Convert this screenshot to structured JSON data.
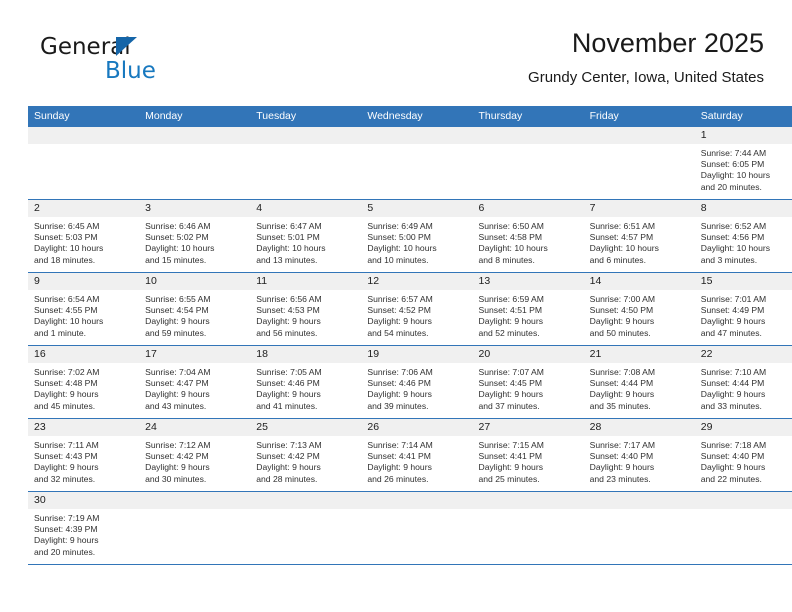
{
  "brand": {
    "name_part1": "General",
    "name_part2": "Blue",
    "triangle_color": "#1565a8",
    "blue_color": "#1778bf"
  },
  "header": {
    "title": "November 2025",
    "subtitle": "Grundy Center, Iowa, United States"
  },
  "theme": {
    "header_bg": "#3275b8",
    "header_text": "#ffffff",
    "daynum_band_bg": "#f0f0f0",
    "row_border": "#3275b8"
  },
  "weekday_headers": [
    "Sunday",
    "Monday",
    "Tuesday",
    "Wednesday",
    "Thursday",
    "Friday",
    "Saturday"
  ],
  "weeks": [
    [
      {
        "day": "",
        "empty": true
      },
      {
        "day": "",
        "empty": true
      },
      {
        "day": "",
        "empty": true
      },
      {
        "day": "",
        "empty": true
      },
      {
        "day": "",
        "empty": true
      },
      {
        "day": "",
        "empty": true
      },
      {
        "day": "1",
        "sunrise": "Sunrise: 7:44 AM",
        "sunset": "Sunset: 6:05 PM",
        "daylight1": "Daylight: 10 hours",
        "daylight2": "and 20 minutes."
      }
    ],
    [
      {
        "day": "2",
        "sunrise": "Sunrise: 6:45 AM",
        "sunset": "Sunset: 5:03 PM",
        "daylight1": "Daylight: 10 hours",
        "daylight2": "and 18 minutes."
      },
      {
        "day": "3",
        "sunrise": "Sunrise: 6:46 AM",
        "sunset": "Sunset: 5:02 PM",
        "daylight1": "Daylight: 10 hours",
        "daylight2": "and 15 minutes."
      },
      {
        "day": "4",
        "sunrise": "Sunrise: 6:47 AM",
        "sunset": "Sunset: 5:01 PM",
        "daylight1": "Daylight: 10 hours",
        "daylight2": "and 13 minutes."
      },
      {
        "day": "5",
        "sunrise": "Sunrise: 6:49 AM",
        "sunset": "Sunset: 5:00 PM",
        "daylight1": "Daylight: 10 hours",
        "daylight2": "and 10 minutes."
      },
      {
        "day": "6",
        "sunrise": "Sunrise: 6:50 AM",
        "sunset": "Sunset: 4:58 PM",
        "daylight1": "Daylight: 10 hours",
        "daylight2": "and 8 minutes."
      },
      {
        "day": "7",
        "sunrise": "Sunrise: 6:51 AM",
        "sunset": "Sunset: 4:57 PM",
        "daylight1": "Daylight: 10 hours",
        "daylight2": "and 6 minutes."
      },
      {
        "day": "8",
        "sunrise": "Sunrise: 6:52 AM",
        "sunset": "Sunset: 4:56 PM",
        "daylight1": "Daylight: 10 hours",
        "daylight2": "and 3 minutes."
      }
    ],
    [
      {
        "day": "9",
        "sunrise": "Sunrise: 6:54 AM",
        "sunset": "Sunset: 4:55 PM",
        "daylight1": "Daylight: 10 hours",
        "daylight2": "and 1 minute."
      },
      {
        "day": "10",
        "sunrise": "Sunrise: 6:55 AM",
        "sunset": "Sunset: 4:54 PM",
        "daylight1": "Daylight: 9 hours",
        "daylight2": "and 59 minutes."
      },
      {
        "day": "11",
        "sunrise": "Sunrise: 6:56 AM",
        "sunset": "Sunset: 4:53 PM",
        "daylight1": "Daylight: 9 hours",
        "daylight2": "and 56 minutes."
      },
      {
        "day": "12",
        "sunrise": "Sunrise: 6:57 AM",
        "sunset": "Sunset: 4:52 PM",
        "daylight1": "Daylight: 9 hours",
        "daylight2": "and 54 minutes."
      },
      {
        "day": "13",
        "sunrise": "Sunrise: 6:59 AM",
        "sunset": "Sunset: 4:51 PM",
        "daylight1": "Daylight: 9 hours",
        "daylight2": "and 52 minutes."
      },
      {
        "day": "14",
        "sunrise": "Sunrise: 7:00 AM",
        "sunset": "Sunset: 4:50 PM",
        "daylight1": "Daylight: 9 hours",
        "daylight2": "and 50 minutes."
      },
      {
        "day": "15",
        "sunrise": "Sunrise: 7:01 AM",
        "sunset": "Sunset: 4:49 PM",
        "daylight1": "Daylight: 9 hours",
        "daylight2": "and 47 minutes."
      }
    ],
    [
      {
        "day": "16",
        "sunrise": "Sunrise: 7:02 AM",
        "sunset": "Sunset: 4:48 PM",
        "daylight1": "Daylight: 9 hours",
        "daylight2": "and 45 minutes."
      },
      {
        "day": "17",
        "sunrise": "Sunrise: 7:04 AM",
        "sunset": "Sunset: 4:47 PM",
        "daylight1": "Daylight: 9 hours",
        "daylight2": "and 43 minutes."
      },
      {
        "day": "18",
        "sunrise": "Sunrise: 7:05 AM",
        "sunset": "Sunset: 4:46 PM",
        "daylight1": "Daylight: 9 hours",
        "daylight2": "and 41 minutes."
      },
      {
        "day": "19",
        "sunrise": "Sunrise: 7:06 AM",
        "sunset": "Sunset: 4:46 PM",
        "daylight1": "Daylight: 9 hours",
        "daylight2": "and 39 minutes."
      },
      {
        "day": "20",
        "sunrise": "Sunrise: 7:07 AM",
        "sunset": "Sunset: 4:45 PM",
        "daylight1": "Daylight: 9 hours",
        "daylight2": "and 37 minutes."
      },
      {
        "day": "21",
        "sunrise": "Sunrise: 7:08 AM",
        "sunset": "Sunset: 4:44 PM",
        "daylight1": "Daylight: 9 hours",
        "daylight2": "and 35 minutes."
      },
      {
        "day": "22",
        "sunrise": "Sunrise: 7:10 AM",
        "sunset": "Sunset: 4:44 PM",
        "daylight1": "Daylight: 9 hours",
        "daylight2": "and 33 minutes."
      }
    ],
    [
      {
        "day": "23",
        "sunrise": "Sunrise: 7:11 AM",
        "sunset": "Sunset: 4:43 PM",
        "daylight1": "Daylight: 9 hours",
        "daylight2": "and 32 minutes."
      },
      {
        "day": "24",
        "sunrise": "Sunrise: 7:12 AM",
        "sunset": "Sunset: 4:42 PM",
        "daylight1": "Daylight: 9 hours",
        "daylight2": "and 30 minutes."
      },
      {
        "day": "25",
        "sunrise": "Sunrise: 7:13 AM",
        "sunset": "Sunset: 4:42 PM",
        "daylight1": "Daylight: 9 hours",
        "daylight2": "and 28 minutes."
      },
      {
        "day": "26",
        "sunrise": "Sunrise: 7:14 AM",
        "sunset": "Sunset: 4:41 PM",
        "daylight1": "Daylight: 9 hours",
        "daylight2": "and 26 minutes."
      },
      {
        "day": "27",
        "sunrise": "Sunrise: 7:15 AM",
        "sunset": "Sunset: 4:41 PM",
        "daylight1": "Daylight: 9 hours",
        "daylight2": "and 25 minutes."
      },
      {
        "day": "28",
        "sunrise": "Sunrise: 7:17 AM",
        "sunset": "Sunset: 4:40 PM",
        "daylight1": "Daylight: 9 hours",
        "daylight2": "and 23 minutes."
      },
      {
        "day": "29",
        "sunrise": "Sunrise: 7:18 AM",
        "sunset": "Sunset: 4:40 PM",
        "daylight1": "Daylight: 9 hours",
        "daylight2": "and 22 minutes."
      }
    ],
    [
      {
        "day": "30",
        "sunrise": "Sunrise: 7:19 AM",
        "sunset": "Sunset: 4:39 PM",
        "daylight1": "Daylight: 9 hours",
        "daylight2": "and 20 minutes."
      },
      {
        "day": "",
        "empty": true
      },
      {
        "day": "",
        "empty": true
      },
      {
        "day": "",
        "empty": true
      },
      {
        "day": "",
        "empty": true
      },
      {
        "day": "",
        "empty": true
      },
      {
        "day": "",
        "empty": true
      }
    ]
  ]
}
